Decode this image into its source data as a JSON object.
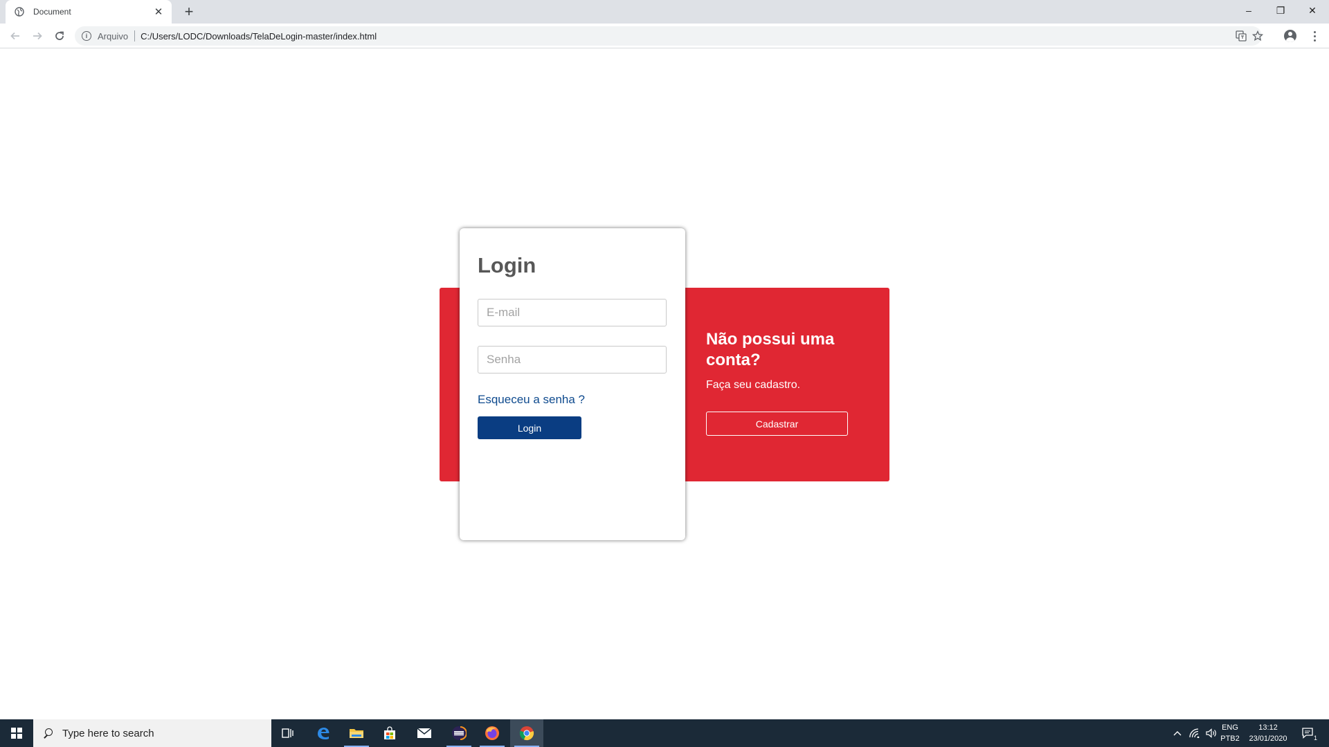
{
  "browser": {
    "tab_title": "Document",
    "tab_close": "✕",
    "new_tab": "+",
    "address_label": "Arquivo",
    "url": "C:/Users/LODC/Downloads/TelaDeLogin-master/index.html",
    "window_controls": [
      "–",
      "❐",
      "✕"
    ]
  },
  "login": {
    "title": "Login",
    "email_placeholder": "E-mail",
    "password_placeholder": "Senha",
    "forgot_link": "Esqueceu a senha ?",
    "button": "Login"
  },
  "signup": {
    "title": "Não possui uma conta?",
    "subtitle": "Faça seu cadastro.",
    "button": "Cadastrar"
  },
  "taskbar": {
    "search_placeholder": "Type here to search",
    "language_top": "ENG",
    "language_bottom": "PTB2",
    "time": "13:12",
    "date": "23/01/2020",
    "notification_count": "1"
  },
  "colors": {
    "red_panel": "#e02733",
    "login_button": "#0a3d82",
    "link": "#0e4a8e",
    "taskbar": "#1b2a38"
  }
}
